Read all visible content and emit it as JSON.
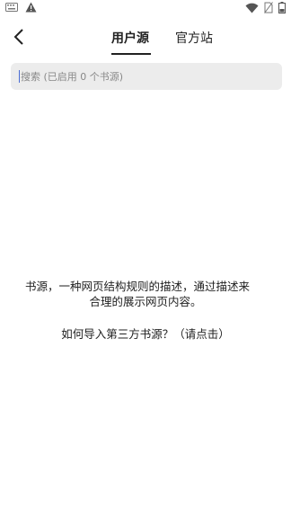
{
  "status_bar": {
    "left_icons": [
      "keyboard-icon",
      "warning-icon"
    ],
    "right_icons": [
      "wifi-icon",
      "no-sim-icon",
      "battery-icon"
    ]
  },
  "top_bar": {
    "tabs": [
      {
        "label": "用户源",
        "selected": true
      },
      {
        "label": "官方站",
        "selected": false
      }
    ]
  },
  "search": {
    "placeholder": "搜索 (已启用 0 个书源)",
    "value": ""
  },
  "empty_state": {
    "line1": "书源，一种网页结构规则的描述，通过描述来",
    "line2": "合理的展示网页内容。",
    "help_link": "如何导入第三方书源？（请点击）"
  },
  "colors": {
    "background": "#ffffff",
    "search_bg": "#ececec",
    "caret": "#4a6cd4",
    "text": "#222222"
  }
}
